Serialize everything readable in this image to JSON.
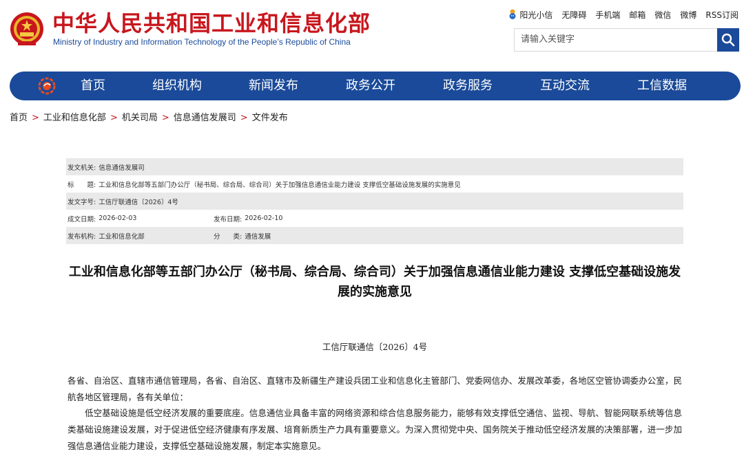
{
  "header": {
    "site_title": "中华人民共和国工业和信息化部",
    "site_subtitle": "Ministry of Industry and Information Technology of the People’s Republic of China",
    "top_links": [
      "阳光小信",
      "无障碍",
      "手机端",
      "邮箱",
      "微信",
      "微博",
      "RSS订阅"
    ],
    "search_placeholder": "请输入关键字"
  },
  "nav": {
    "items": [
      "首页",
      "组织机构",
      "新闻发布",
      "政务公开",
      "政务服务",
      "互动交流",
      "工信数据"
    ]
  },
  "breadcrumb": [
    "首页",
    "工业和信息化部",
    "机关司局",
    "信息通信发展司",
    "文件发布"
  ],
  "meta": {
    "issuing_body_label": "发文机关:",
    "issuing_body": "信息通信发展司",
    "title_label": "标　　题:",
    "title": "工业和信息化部等五部门办公厅（秘书局、综合局、综合司）关于加强信息通信业能力建设 支撑低空基础设施发展的实施意见",
    "doc_no_label": "发文字号:",
    "doc_no": "工信厅联通信〔2026〕4号",
    "created_label": "成文日期:",
    "created": "2026-02-03",
    "published_label": "发布日期:",
    "published": "2026-02-10",
    "publisher_label": "发布机构:",
    "publisher": "工业和信息化部",
    "category_label": "分　　类:",
    "category": "通信发展"
  },
  "article": {
    "title": "工业和信息化部等五部门办公厅（秘书局、综合局、综合司）关于加强信息通信业能力建设 支撑低空基础设施发展的实施意见",
    "doc_number": "工信厅联通信〔2026〕4号",
    "paragraphs": [
      "各省、自治区、直辖市通信管理局，各省、自治区、直辖市及新疆生产建设兵团工业和信息化主管部门、党委网信办、发展改革委，各地区空管协调委办公室，民航各地区管理局，各有关单位：",
      "低空基础设施是低空经济发展的重要底座。信息通信业具备丰富的网络资源和综合信息服务能力，能够有效支撑低空通信、监视、导航、智能网联系统等信息类基础设施建设发展，对于促进低空经济健康有序发展、培育新质生产力具有重要意义。为深入贯彻党中央、国务院关于推动低空经济发展的决策部署，进一步加强信息通信业能力建设，支撑低空基础设施发展，制定本实施意见。"
    ]
  },
  "colors": {
    "brand_red": "#c8161d",
    "brand_blue": "#1a4a99",
    "meta_shade": "#e9e9e9"
  },
  "icons": [
    "national-emblem-icon",
    "sun-mascot-icon",
    "search-icon",
    "nav-logo-icon"
  ]
}
